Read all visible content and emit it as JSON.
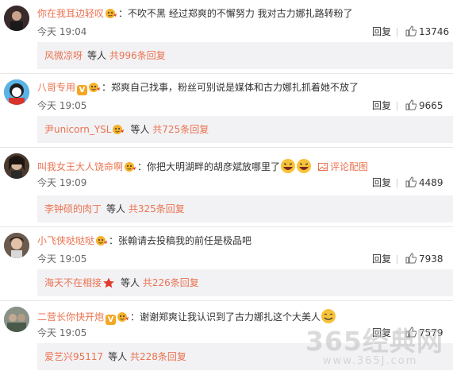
{
  "comments": [
    {
      "username": "你在我耳边轻叹",
      "text": "不吹不黑 经过郑爽的不懈努力 我对古力娜扎路转粉了",
      "time": "今天 19:04",
      "reply_label": "回复",
      "likes": "13746",
      "sub_user": "风微凉呀",
      "sub_deng": "等人",
      "sub_more": "共996条回复"
    },
    {
      "username": "八哥专用",
      "badge": "V",
      "text": "郑爽自己找事，粉丝可别说是媒体和古力娜扎抓着她不放了",
      "time": "今天 19:05",
      "reply_label": "回复",
      "likes": "9665",
      "sub_user": "尹unicorn_YSL",
      "sub_deng": "等人",
      "sub_more": "共725条回复"
    },
    {
      "username": "叫我女王大人饶命啊",
      "text": "你把大明湖畔的胡彦斌放哪里了",
      "pic_link": "评论配图",
      "time": "今天 19:09",
      "reply_label": "回复",
      "likes": "4489",
      "sub_user": "李钟硕的肉丁",
      "sub_deng": "等人",
      "sub_more": "共325条回复"
    },
    {
      "username": "小飞侠哒哒哒",
      "text": "张翰请去投稿我的前任是极品吧",
      "time": "今天 19:05",
      "reply_label": "回复",
      "likes": "7938",
      "sub_user": "海天不在相接",
      "sub_deng": "等人",
      "sub_more": "共226条回复"
    },
    {
      "username": "二营长你快开炮",
      "badge": "V",
      "text": "谢谢郑爽让我认识到了古力娜扎这个大美人",
      "time": "今天 19:05",
      "reply_label": "回复",
      "likes": "7579",
      "sub_user": "爱艺兴95117",
      "sub_deng": "等人",
      "sub_more": "共228条回复"
    }
  ],
  "watermark": {
    "main": "365经典网",
    "url": "www.365J.com"
  },
  "colors": {
    "link": "#eb7350",
    "badge": "#f5a623",
    "sub_bg": "#f2f2f5"
  }
}
